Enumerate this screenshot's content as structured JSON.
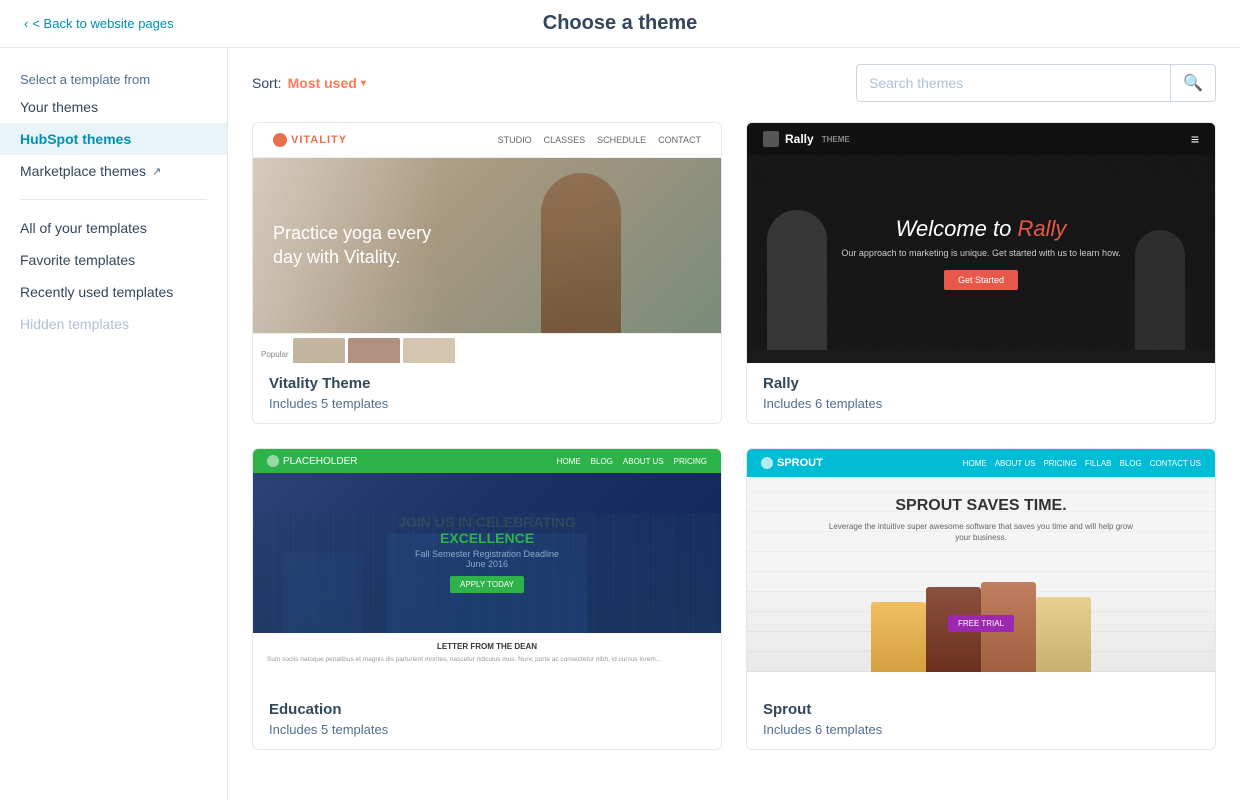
{
  "header": {
    "back_label": "< Back to website pages",
    "title": "Choose a theme"
  },
  "sidebar": {
    "section_label": "Select a template from",
    "items": [
      {
        "id": "your-themes",
        "label": "Your themes",
        "active": false,
        "muted": false
      },
      {
        "id": "hubspot-themes",
        "label": "HubSpot themes",
        "active": true,
        "muted": false
      },
      {
        "id": "marketplace-themes",
        "label": "Marketplace themes",
        "active": false,
        "muted": false,
        "has_ext": true
      }
    ],
    "divider": true,
    "sub_items": [
      {
        "id": "all-templates",
        "label": "All of your templates",
        "muted": false
      },
      {
        "id": "favorite-templates",
        "label": "Favorite templates",
        "muted": false
      },
      {
        "id": "recent-templates",
        "label": "Recently used templates",
        "muted": false
      },
      {
        "id": "hidden-templates",
        "label": "Hidden templates",
        "muted": true
      }
    ]
  },
  "toolbar": {
    "sort_label": "Sort:",
    "sort_value": "Most used",
    "search_placeholder": "Search themes"
  },
  "themes": [
    {
      "id": "vitality",
      "name": "Vitality Theme",
      "template_count": "Includes 5 templates"
    },
    {
      "id": "rally",
      "name": "Rally",
      "template_count": "Includes 6 templates"
    },
    {
      "id": "education",
      "name": "Education",
      "template_count": "Includes 5 templates"
    },
    {
      "id": "sprout",
      "name": "Sprout",
      "template_count": "Includes 6 templates"
    }
  ]
}
